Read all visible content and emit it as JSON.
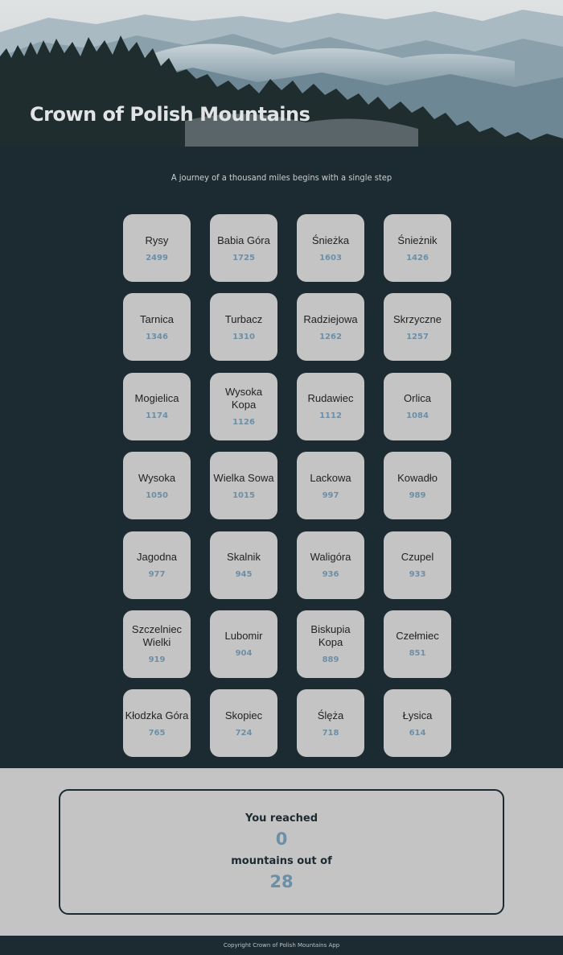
{
  "hero": {
    "title": "Crown of Polish Mountains"
  },
  "tagline": "A journey of a thousand miles begins with a single step",
  "mountains": [
    {
      "name": "Rysy",
      "height": "2499"
    },
    {
      "name": "Babia Góra",
      "height": "1725"
    },
    {
      "name": "Śnieżka",
      "height": "1603"
    },
    {
      "name": "Śnieżnik",
      "height": "1426"
    },
    {
      "name": "Tarnica",
      "height": "1346"
    },
    {
      "name": "Turbacz",
      "height": "1310"
    },
    {
      "name": "Radziejowa",
      "height": "1262"
    },
    {
      "name": "Skrzyczne",
      "height": "1257"
    },
    {
      "name": "Mogielica",
      "height": "1174"
    },
    {
      "name": "Wysoka Kopa",
      "height": "1126"
    },
    {
      "name": "Rudawiec",
      "height": "1112"
    },
    {
      "name": "Orlica",
      "height": "1084"
    },
    {
      "name": "Wysoka",
      "height": "1050"
    },
    {
      "name": "Wielka Sowa",
      "height": "1015"
    },
    {
      "name": "Lackowa",
      "height": "997"
    },
    {
      "name": "Kowadło",
      "height": "989"
    },
    {
      "name": "Jagodna",
      "height": "977"
    },
    {
      "name": "Skalnik",
      "height": "945"
    },
    {
      "name": "Waligóra",
      "height": "936"
    },
    {
      "name": "Czupel",
      "height": "933"
    },
    {
      "name": "Szczelniec Wielki",
      "height": "919"
    },
    {
      "name": "Lubomir",
      "height": "904"
    },
    {
      "name": "Biskupia Kopa",
      "height": "889"
    },
    {
      "name": "Czełmiec",
      "height": "851"
    },
    {
      "name": "Kłodzka Góra",
      "height": "765"
    },
    {
      "name": "Skopiec",
      "height": "724"
    },
    {
      "name": "Ślęża",
      "height": "718"
    },
    {
      "name": "Łysica",
      "height": "614"
    }
  ],
  "summary": {
    "reached_label": "You reached",
    "reached_count": "0",
    "out_of_label": "mountains out of",
    "total_count": "28"
  },
  "footer": {
    "text": "Copyright Crown of Polish Mountains App"
  },
  "colors": {
    "background": "#1c2a31",
    "card": "#c4c4c4",
    "accent": "#6d8fa6"
  }
}
